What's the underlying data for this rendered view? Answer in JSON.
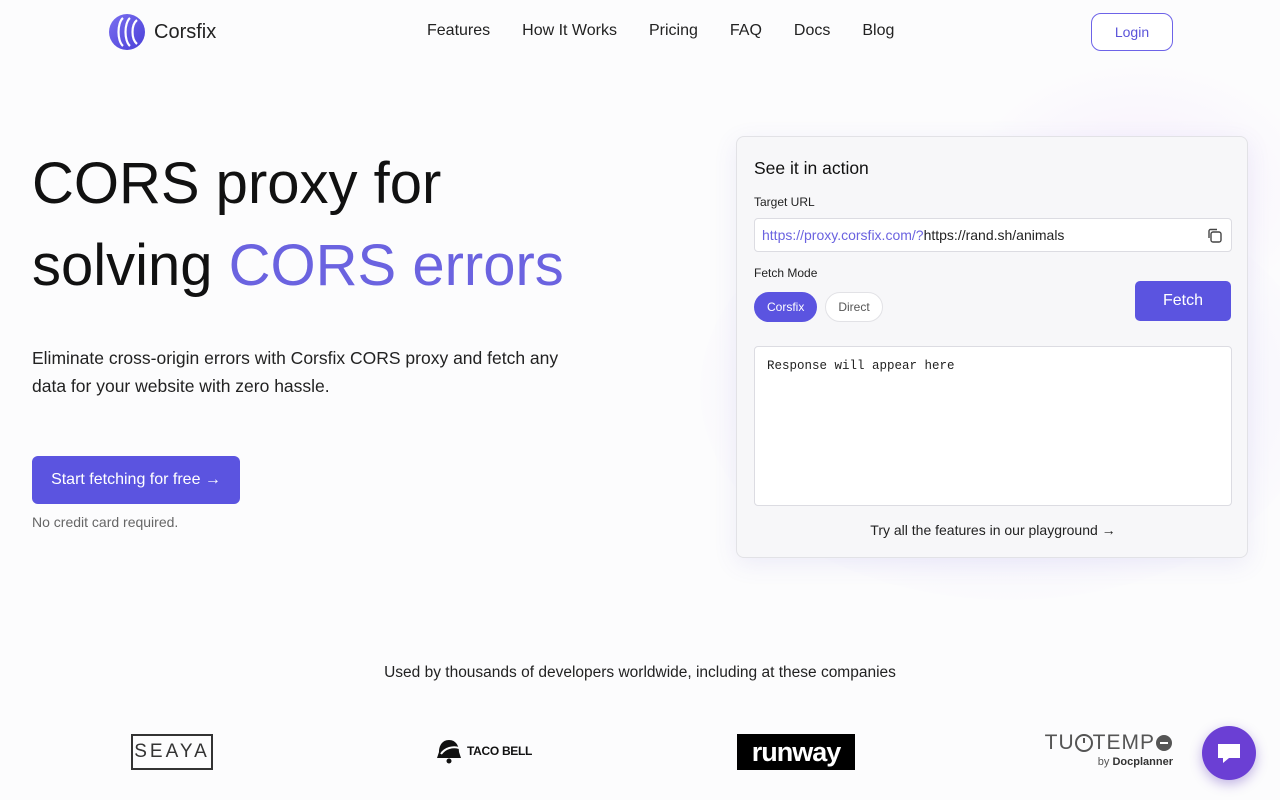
{
  "brand": {
    "name": "Corsfix"
  },
  "nav": {
    "links": [
      "Features",
      "How It Works",
      "Pricing",
      "FAQ",
      "Docs",
      "Blog"
    ],
    "login_label": "Login"
  },
  "hero": {
    "title_line1": "CORS proxy for",
    "title_line2_plain": "solving ",
    "title_line2_accent": "CORS errors",
    "subtitle": "Eliminate cross-origin errors with Corsfix CORS proxy and fetch any data for your website with zero hassle.",
    "cta_label": "Start fetching for free →",
    "cta_note": "No credit card required."
  },
  "demo": {
    "title": "See it in action",
    "target_url_label": "Target URL",
    "url_prefix": "https://proxy.corsfix.com/?",
    "url_value": "https://rand.sh/animals",
    "fetch_mode_label": "Fetch Mode",
    "modes": [
      "Corsfix",
      "Direct"
    ],
    "active_mode": "Corsfix",
    "fetch_label": "Fetch",
    "response_placeholder": "Response will appear here",
    "playground_link": "Try all the features in our playground →"
  },
  "companies": {
    "title": "Used by thousands of developers worldwide, including at these companies",
    "logos": {
      "seaya": "SEAYA",
      "tacobell": "TACO BELL",
      "runway": "runway",
      "tuotempo_left": "TU",
      "tuotempo_right": "TEMP",
      "tuotempo_by": "by",
      "tuotempo_by_brand": "Docplanner"
    }
  },
  "colors": {
    "accent": "#5b54e0",
    "accent_text": "#6b63e0",
    "chat": "#6b3fd4"
  },
  "icons": {
    "copy": "copy-icon",
    "chat": "chat-icon",
    "logo": "corsfix-logo-icon"
  }
}
